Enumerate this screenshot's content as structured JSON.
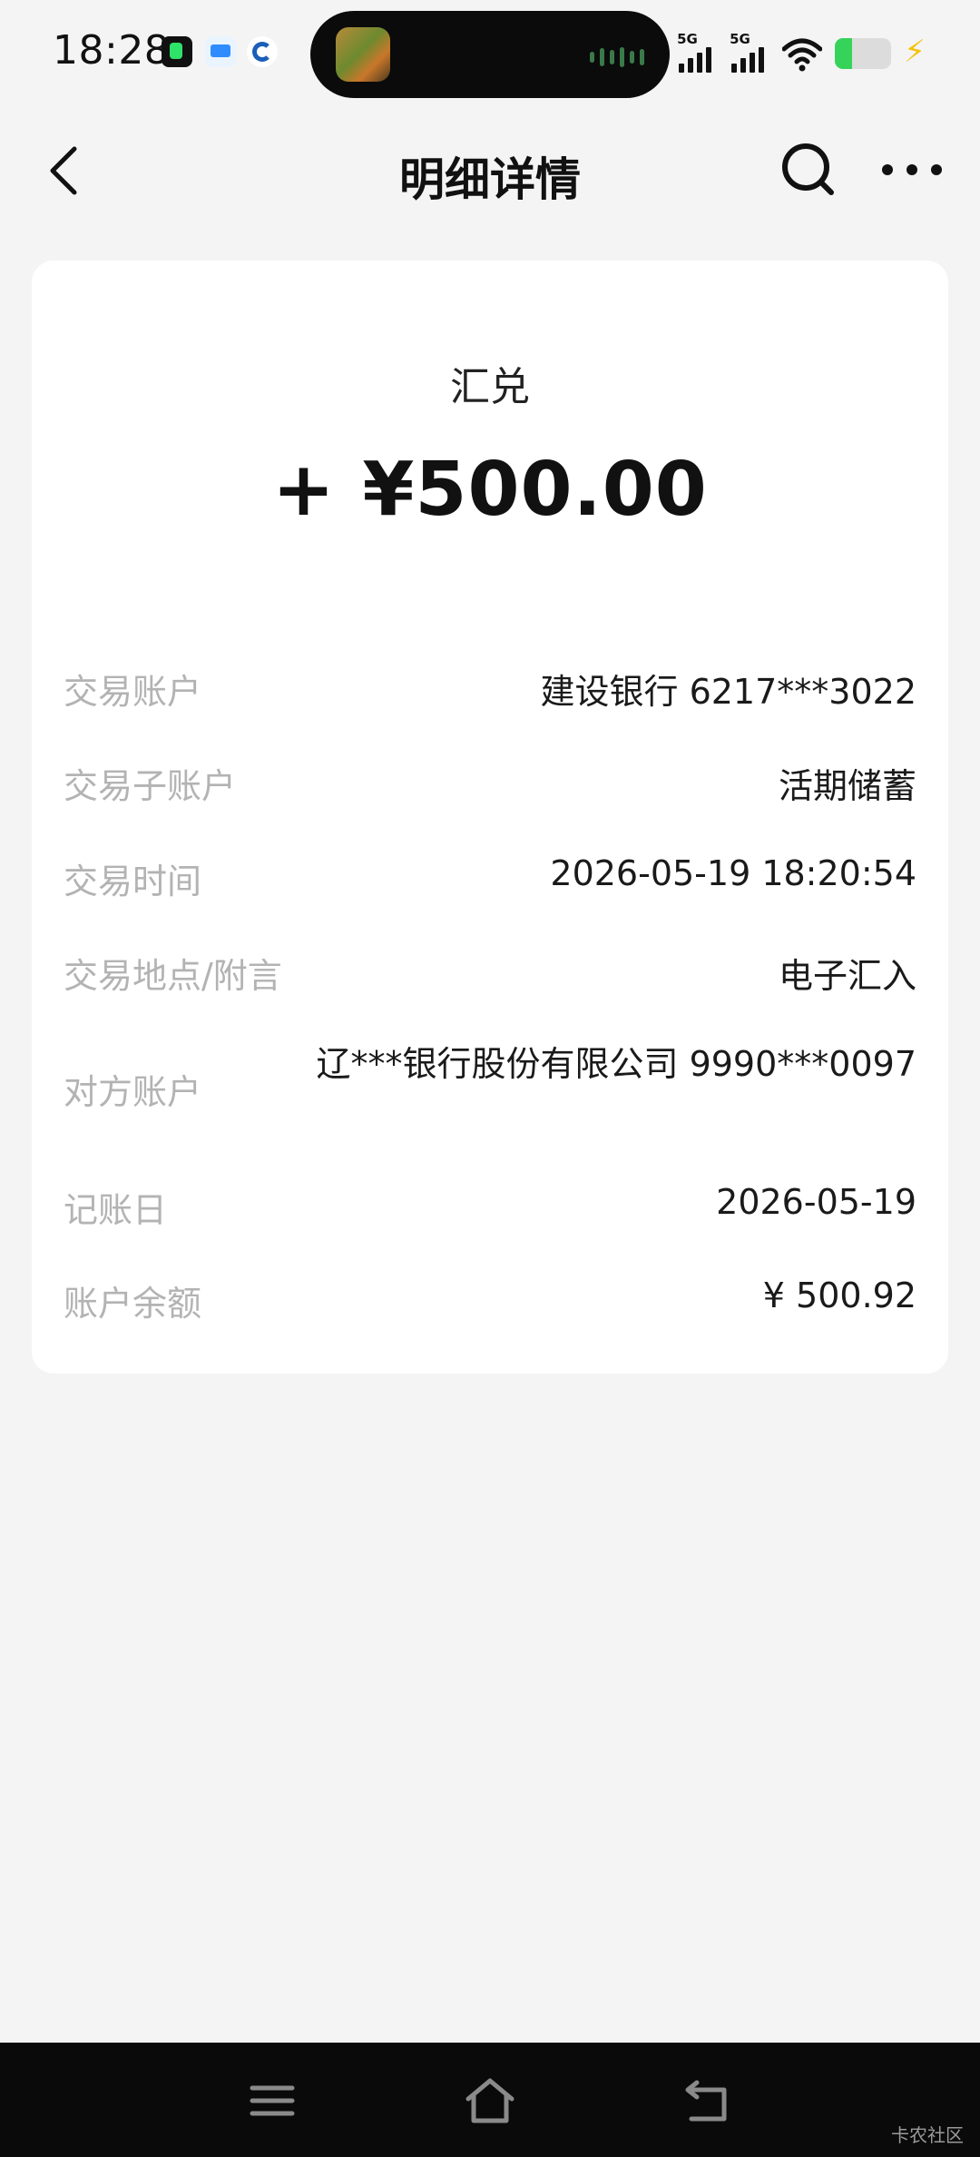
{
  "status_bar": {
    "time": "18:28",
    "network_1": "5G",
    "network_2": "5G",
    "battery_level": 0.3,
    "icons": [
      "music-app-icon",
      "message-app-icon",
      "ccb-app-icon",
      "wifi-icon",
      "battery-icon",
      "charging-icon"
    ]
  },
  "header": {
    "title": "明细详情",
    "back_icon": "chevron-left-icon",
    "search_icon": "search-icon",
    "more_icon": "more-icon"
  },
  "transaction": {
    "type": "汇兑",
    "amount": "+ ¥500.00"
  },
  "details": [
    {
      "label": "交易账户",
      "value": "建设银行 6217***3022"
    },
    {
      "label": "交易子账户",
      "value": "活期储蓄"
    },
    {
      "label": "交易时间",
      "value": "2026-05-19 18:20:54"
    },
    {
      "label": "交易地点/附言",
      "value": "电子汇入"
    },
    {
      "label": "对方账户",
      "value": "辽***银行股份有限公司 9990***0097"
    },
    {
      "label": "记账日",
      "value": "2026-05-19"
    },
    {
      "label": "账户余额",
      "value": "¥ 500.92"
    }
  ],
  "bottom_nav": {
    "icons": [
      "menu-icon",
      "home-icon",
      "back-icon"
    ]
  },
  "watermark": "卡农社区",
  "colors": {
    "background": "#f4f4f4",
    "card": "#ffffff",
    "label": "#b3b3b3",
    "value": "#1a1a1a"
  }
}
